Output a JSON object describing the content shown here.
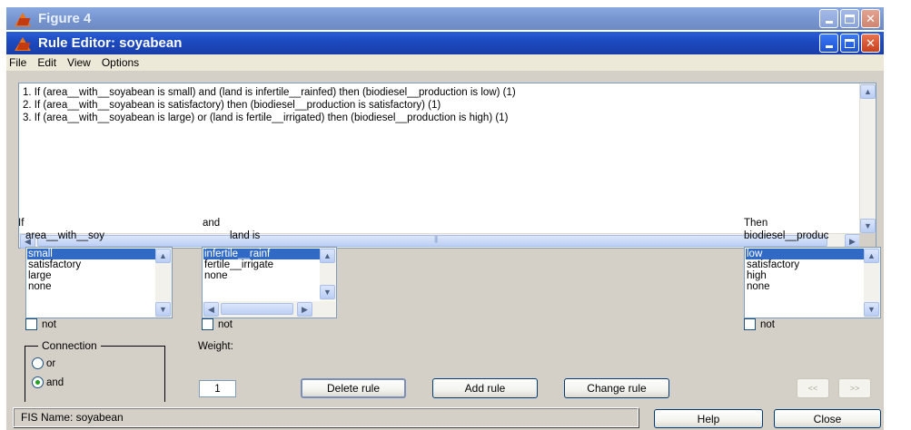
{
  "outer_window": {
    "title": "Figure 4"
  },
  "inner_window": {
    "title": "Rule Editor: soyabean"
  },
  "menu": [
    "File",
    "Edit",
    "View",
    "Options"
  ],
  "rules": [
    "1. If (area__with__soyabean is small) and (land is infertile__rainfed) then (biodiesel__production is low) (1)",
    "2. If (area__with__soyabean is satisfactory) then (biodiesel__production is satisfactory) (1)",
    "3. If (area__with__soyabean is large) or (land is fertile__irrigated) then (biodiesel__production is high) (1)"
  ],
  "input1": {
    "prefix": "If",
    "name": "area__with__soy",
    "items": [
      "small",
      "satisfactory",
      "large",
      "none"
    ],
    "selected": "small",
    "not_label": "not"
  },
  "input2": {
    "prefix": "and",
    "name": "land is",
    "items": [
      "infertile__rainf",
      "fertile__irrigate",
      "none"
    ],
    "selected": "infertile__rainf",
    "not_label": "not"
  },
  "output": {
    "prefix": "Then",
    "name": "biodiesel__produc",
    "items": [
      "low",
      "satisfactory",
      "high",
      "none"
    ],
    "selected": "low",
    "not_label": "not"
  },
  "connection": {
    "title": "Connection",
    "options": [
      "or",
      "and"
    ],
    "selected": "and"
  },
  "weight": {
    "label": "Weight:",
    "value": "1"
  },
  "buttons": {
    "delete": "Delete rule",
    "add": "Add rule",
    "change": "Change rule",
    "prev": "<<",
    "next": ">>",
    "help": "Help",
    "close": "Close"
  },
  "status": {
    "fis_name": "FIS Name: soyabean"
  },
  "colors": {
    "selection": "#316ac5",
    "titlebar": "#1c49bf",
    "face": "#d4d0c8"
  }
}
